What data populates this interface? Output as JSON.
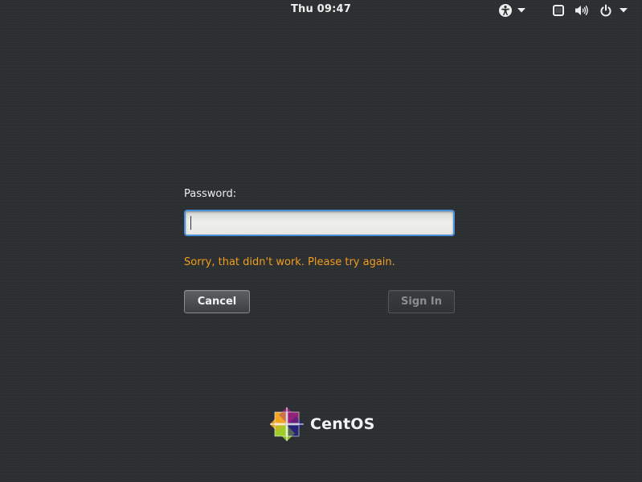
{
  "top_bar": {
    "clock": "Thu 09:47",
    "indicators": {
      "accessibility_icon": "accessibility-icon",
      "menu_arrow_icon": "chevron-down-icon",
      "display_icon": "screen-icon",
      "volume_icon": "speaker-icon",
      "power_icon": "power-icon"
    }
  },
  "login": {
    "prompt_label": "Password:",
    "password_value": "",
    "error_message": "Sorry, that didn't work. Please try again.",
    "cancel_label": "Cancel",
    "sign_in_label": "Sign In"
  },
  "branding": {
    "logo_icon": "centos-logo",
    "name": "CentOS"
  },
  "colors": {
    "background": "#2c2f31",
    "error_text": "#f19d1d",
    "focus_ring": "#4a90d9",
    "logo_yellow": "#efa724",
    "logo_green": "#9ccd2a",
    "logo_blue": "#262577",
    "logo_purple": "#932279"
  }
}
